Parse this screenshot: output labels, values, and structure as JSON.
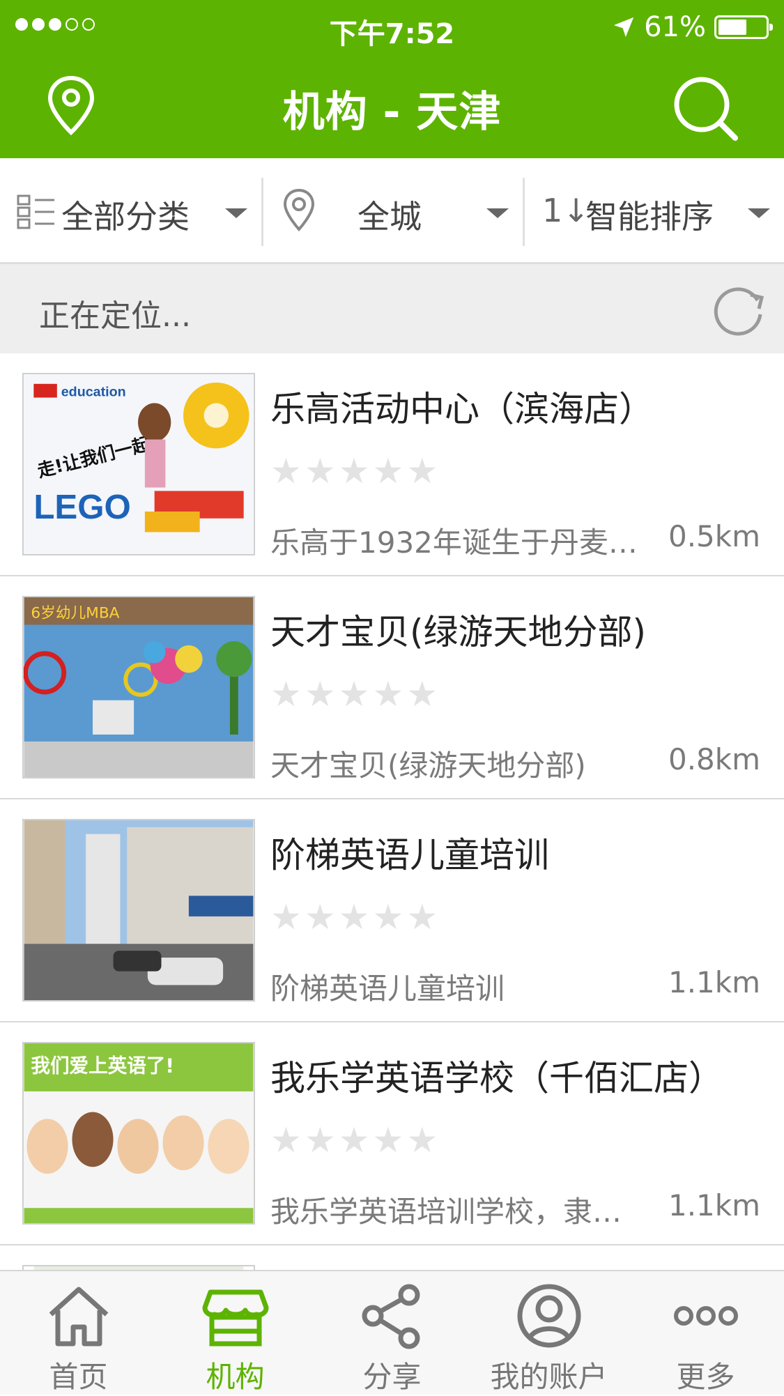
{
  "status_bar": {
    "time": "下午7:52",
    "battery": "61%",
    "battery_level": 0.61
  },
  "nav": {
    "title": "机构 - 天津",
    "location_icon": "location-pin-icon",
    "search_icon": "search-icon"
  },
  "filters": [
    {
      "label": "全部分类",
      "icon": "category-list-icon"
    },
    {
      "label": "全城",
      "icon": "location-pin-icon"
    },
    {
      "label": "智能排序",
      "icon": "sort-icon"
    }
  ],
  "sort_glyph": "1↓",
  "locating": {
    "text": "正在定位...",
    "icon": "refresh-icon"
  },
  "items": [
    {
      "title": "乐高活动中心（滨海店）",
      "desc": "乐高于1932年诞生于丹麦…",
      "distance": "0.5km",
      "rating": 0
    },
    {
      "title": "天才宝贝(绿游天地分部)",
      "desc": "天才宝贝(绿游天地分部)",
      "distance": "0.8km",
      "rating": 0
    },
    {
      "title": "阶梯英语儿童培训",
      "desc": "阶梯英语儿童培训",
      "distance": "1.1km",
      "rating": 0
    },
    {
      "title": "我乐学英语学校（千佰汇店）",
      "desc": "我乐学英语培训学校，隶…",
      "distance": "1.1km",
      "rating": 0
    }
  ],
  "thumb_text": {
    "lego_brand": "education",
    "lego_logo": "LEGO",
    "lego_slogan": "走!让我们一起",
    "kindergarten_sign": "6岁幼儿MBA",
    "english_banner": "我们爱上英语了!"
  },
  "tabs": [
    {
      "label": "首页",
      "icon": "home-icon",
      "active": false
    },
    {
      "label": "机构",
      "icon": "store-icon",
      "active": true
    },
    {
      "label": "分享",
      "icon": "share-icon",
      "active": false
    },
    {
      "label": "我的账户",
      "icon": "account-icon",
      "active": false
    },
    {
      "label": "更多",
      "icon": "more-icon",
      "active": false
    }
  ],
  "colors": {
    "brand": "#5db301",
    "inactive": "#777777",
    "star_empty": "#e3e3e3"
  }
}
